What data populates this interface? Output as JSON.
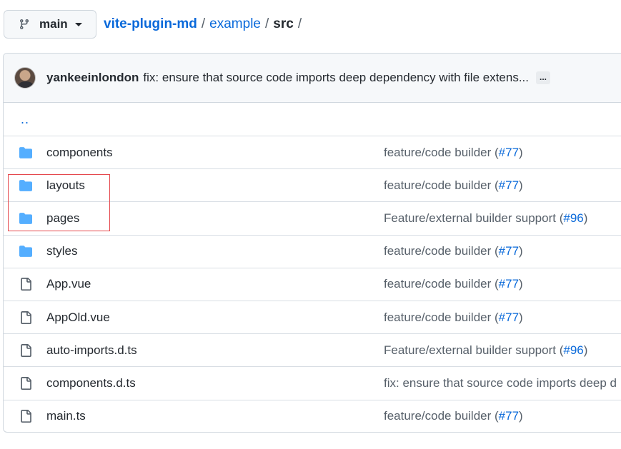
{
  "branch": {
    "name": "main"
  },
  "breadcrumb": {
    "repo": "vite-plugin-md",
    "folder": "example",
    "current": "src",
    "trailing_sep": "/"
  },
  "commit": {
    "author": "yankeeinlondon",
    "message": "fix: ensure that source code imports deep dependency with file extens...",
    "more": "..."
  },
  "parent_link": "..",
  "files": [
    {
      "type": "folder",
      "icon": "folder-icon",
      "name": "components",
      "message": "feature/code builder (",
      "pr": "#77",
      "close": ")"
    },
    {
      "type": "folder",
      "icon": "folder-icon",
      "name": "layouts",
      "message": "feature/code builder (",
      "pr": "#77",
      "close": ")"
    },
    {
      "type": "folder",
      "icon": "folder-icon",
      "name": "pages",
      "message": "Feature/external builder support (",
      "pr": "#96",
      "close": ")"
    },
    {
      "type": "folder",
      "icon": "folder-icon",
      "name": "styles",
      "message": "feature/code builder (",
      "pr": "#77",
      "close": ")"
    },
    {
      "type": "file",
      "icon": "file-icon",
      "name": "App.vue",
      "message": "feature/code builder (",
      "pr": "#77",
      "close": ")"
    },
    {
      "type": "file",
      "icon": "file-icon",
      "name": "AppOld.vue",
      "message": "feature/code builder (",
      "pr": "#77",
      "close": ")"
    },
    {
      "type": "file",
      "icon": "file-icon",
      "name": "auto-imports.d.ts",
      "message": "Feature/external builder support (",
      "pr": "#96",
      "close": ")"
    },
    {
      "type": "file",
      "icon": "file-icon",
      "name": "components.d.ts",
      "message": "fix: ensure that source code imports deep d",
      "pr": "",
      "close": ""
    },
    {
      "type": "file",
      "icon": "file-icon",
      "name": "main.ts",
      "message": "feature/code builder (",
      "pr": "#77",
      "close": ")"
    }
  ],
  "colors": {
    "accent": "#0969da",
    "folder": "#54aeff",
    "highlight": "#e5484d"
  }
}
